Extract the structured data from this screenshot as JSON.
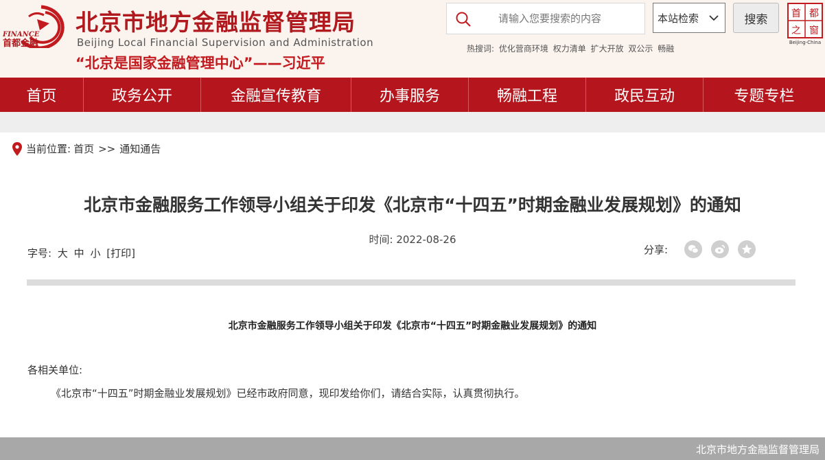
{
  "header": {
    "emblem": {
      "finance_text": "FINANCE",
      "name": "首都金融"
    },
    "title_cn": "北京市地方金融监督管理局",
    "title_en": "Beijing Local Financial Supervision and Administration",
    "slogan": "“北京是国家金融管理中心”——习近平",
    "search": {
      "placeholder": "请输入您要搜索的内容",
      "scope": "本站检索",
      "button": "搜索"
    },
    "hotwords_label": "热搜词:",
    "hotwords": [
      "优化营商环境",
      "权力清单",
      "扩大开放",
      "双公示",
      "畅融"
    ],
    "capital_logo": {
      "chars": [
        "首",
        "都",
        "之",
        "窗"
      ],
      "en": "Beijing-China"
    }
  },
  "nav": {
    "items": [
      "首页",
      "政务公开",
      "金融宣传教育",
      "办事服务",
      "畅融工程",
      "政民互动",
      "专题专栏"
    ]
  },
  "breadcrumb": {
    "label": "当前位置:",
    "home": "首页",
    "sep": ">>",
    "current": "通知通告"
  },
  "article": {
    "title": "北京市金融服务工作领导小组关于印发《北京市“十四五”时期金融业发展规划》的通知",
    "time": "时间: 2022-08-26",
    "fontsize_label": "字号:",
    "fontsize_options": [
      "大",
      "中",
      "小"
    ],
    "print": "[打印]",
    "share_label": "分享:",
    "share_icons": [
      "wechat-icon",
      "weibo-icon",
      "favorite-icon"
    ],
    "doc_title": "北京市金融服务工作领导小组关于印发《北京市“十四五”时期金融业发展规划》的通知",
    "salutation": "各相关单位:",
    "body": "《北京市“十四五”时期金融业发展规划》已经市政府同意，现印发给你们，请结合实际，认真贯彻执行。"
  },
  "footer": {
    "text": "北京市地方金融监督管理局"
  },
  "colors": {
    "brand_red": "#b5161d",
    "header_bg": "#fbf3ee",
    "footer_gray": "#a8a8a8"
  }
}
